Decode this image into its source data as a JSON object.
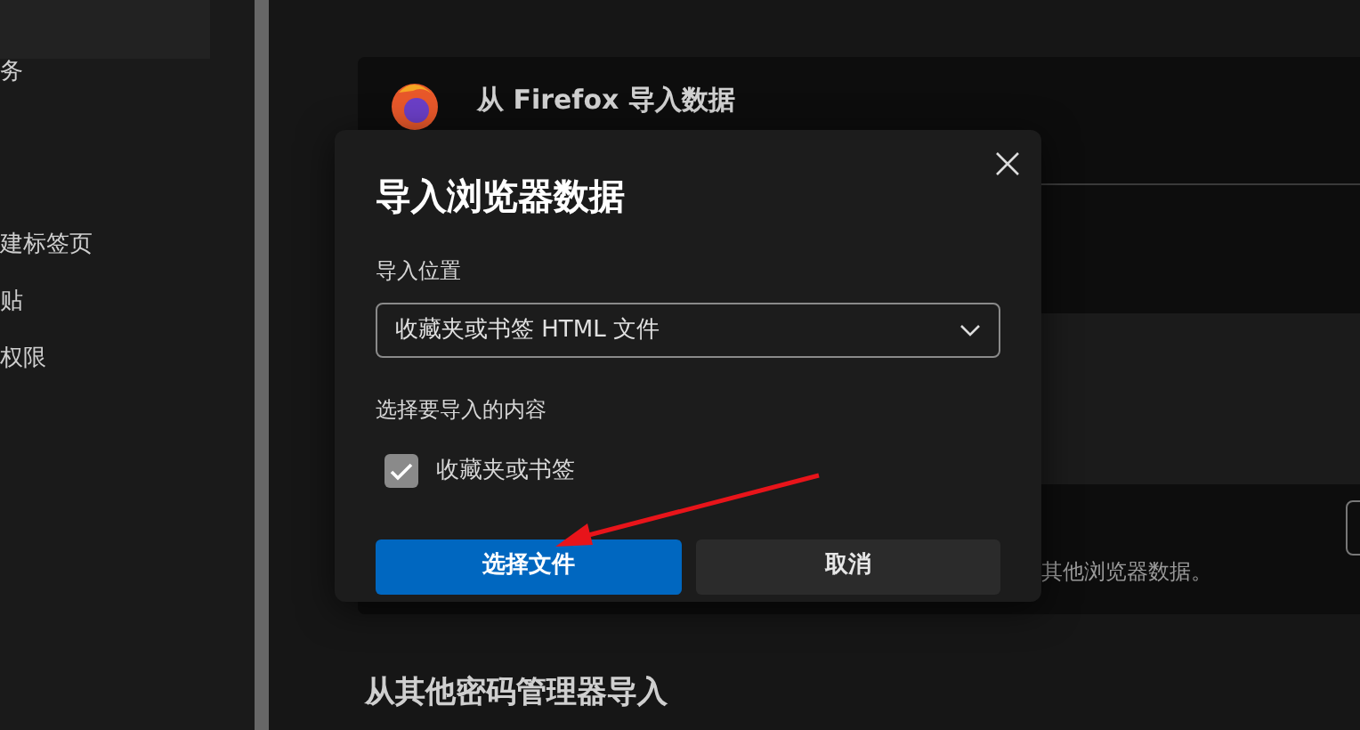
{
  "sidebar": {
    "items": [
      {
        "label": "务"
      },
      {
        "label": "建标签页"
      },
      {
        "label": "贴"
      },
      {
        "label": "权限"
      }
    ]
  },
  "import_card": {
    "title": "从 Firefox 导入数据",
    "description": "其他浏览器数据。"
  },
  "section_heading": "从其他密码管理器导入",
  "dialog": {
    "title": "导入浏览器数据",
    "location_label": "导入位置",
    "location_value": "收藏夹或书签 HTML 文件",
    "content_label": "选择要导入的内容",
    "options": [
      {
        "label": "收藏夹或书签",
        "checked": true
      }
    ],
    "buttons": [
      {
        "label": "选择文件",
        "kind": "primary"
      },
      {
        "label": "取消",
        "kind": "secondary"
      }
    ]
  }
}
